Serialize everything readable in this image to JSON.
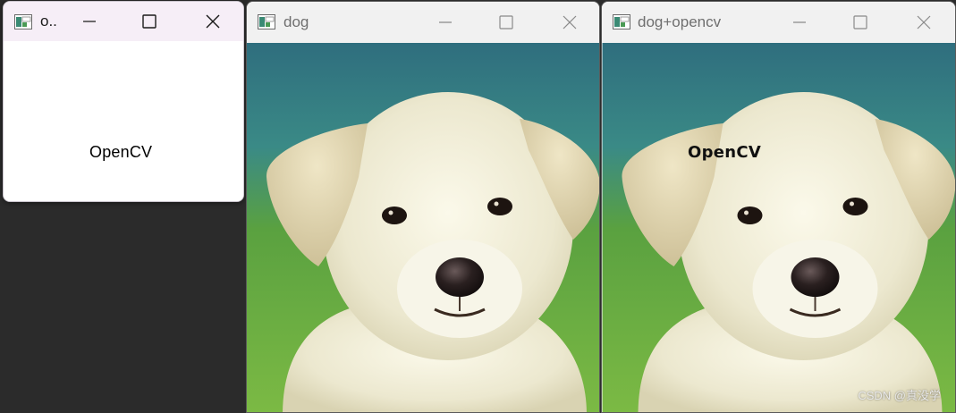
{
  "windows": [
    {
      "title": "o..",
      "content_text": "OpenCV"
    },
    {
      "title": "dog"
    },
    {
      "title": "dog+opencv",
      "overlay_text": "OpenCV"
    }
  ],
  "watermark": "CSDN @真没学",
  "colors": {
    "desktop": "#2b2b2b",
    "titlebar_active": "#f6eef7",
    "titlebar_inactive": "#f1f1f1",
    "background_top": "#2e7180",
    "background_bottom": "#5aa43a",
    "fur": "#f2efd9"
  },
  "icons": [
    "app-icon",
    "minimize-icon",
    "maximize-icon",
    "close-icon"
  ]
}
